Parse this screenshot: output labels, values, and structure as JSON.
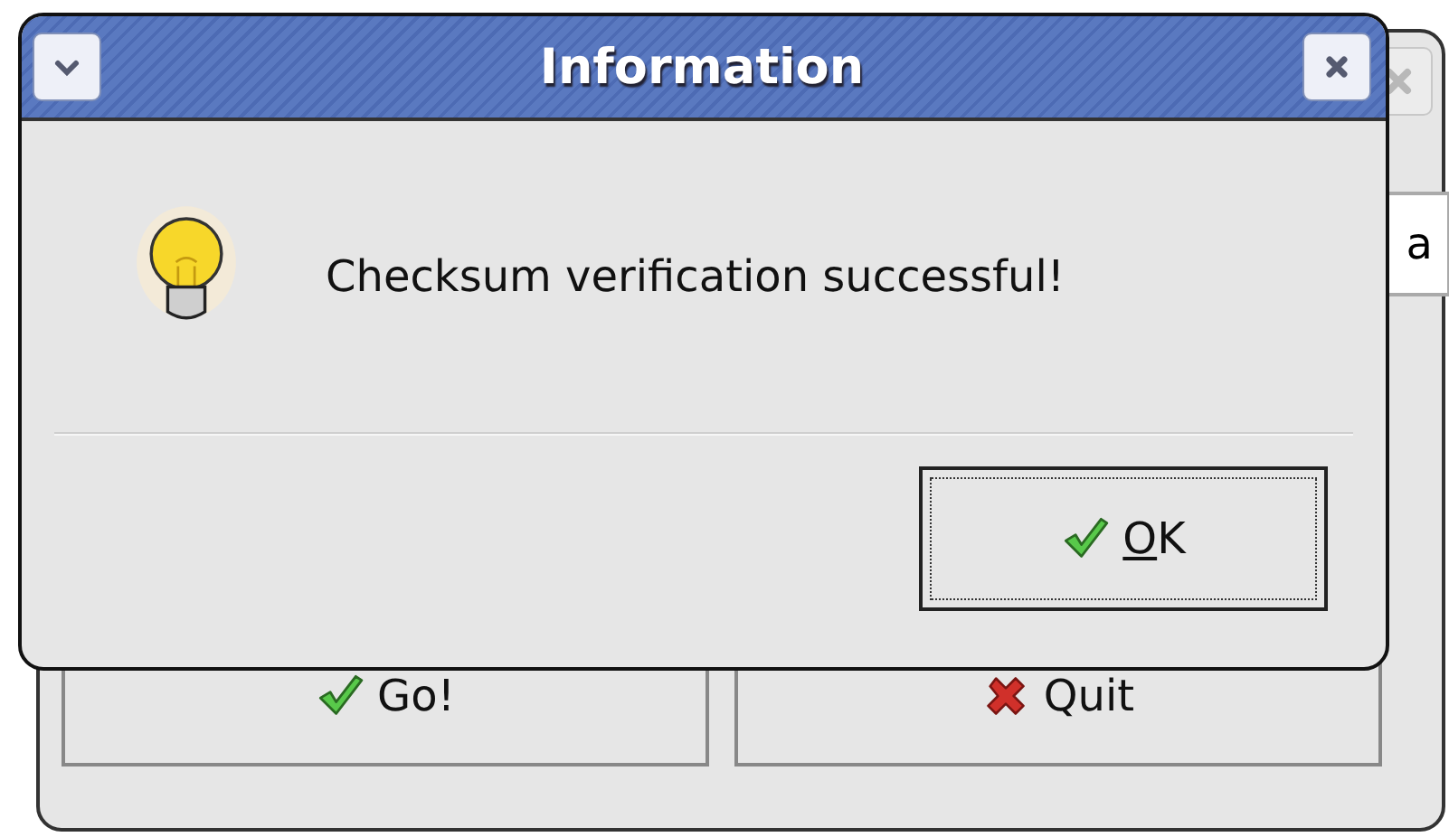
{
  "background_window": {
    "field_value": "a",
    "buttons": [
      {
        "label": "Go!",
        "kind": "confirm"
      },
      {
        "label": "Quit",
        "kind": "cancel"
      }
    ]
  },
  "dialog": {
    "title": "Information",
    "message": "Checksum verification successful!",
    "buttons": [
      {
        "label": "OK",
        "kind": "confirm",
        "focused": true,
        "mnemonic": true
      }
    ]
  }
}
